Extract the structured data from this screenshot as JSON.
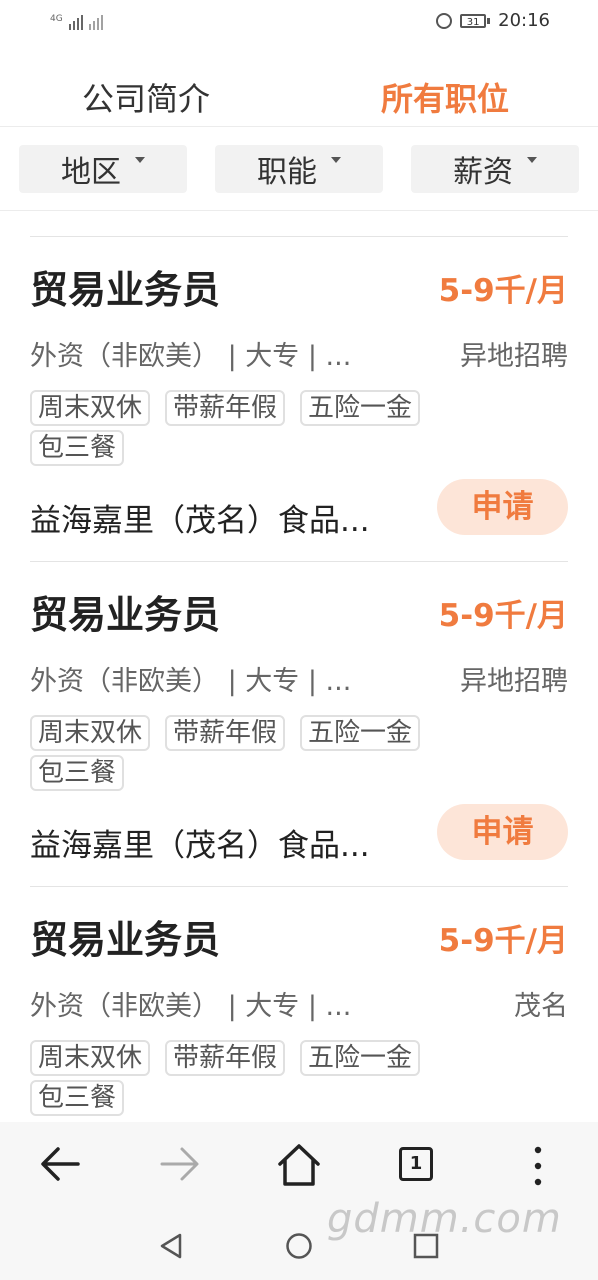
{
  "status_bar": {
    "network_label": "4G",
    "time": "20:16",
    "battery_level": "31"
  },
  "tabs": [
    {
      "label": "公司简介",
      "active": false
    },
    {
      "label": "所有职位",
      "active": true
    }
  ],
  "filters": [
    {
      "label": "地区"
    },
    {
      "label": "职能"
    },
    {
      "label": "薪资"
    }
  ],
  "jobs": [
    {
      "title": "贸易业务员",
      "salary": "5-9千/月",
      "meta": "外资（非欧美） | 大专 | ...",
      "location": "异地招聘",
      "tags": [
        "周末双休",
        "带薪年假",
        "五险一金",
        "包三餐"
      ],
      "company": "益海嘉里（茂名）食品...",
      "apply_label": "申请"
    },
    {
      "title": "贸易业务员",
      "salary": "5-9千/月",
      "meta": "外资（非欧美） | 大专 | ...",
      "location": "异地招聘",
      "tags": [
        "周末双休",
        "带薪年假",
        "五险一金",
        "包三餐"
      ],
      "company": "益海嘉里（茂名）食品...",
      "apply_label": "申请"
    },
    {
      "title": "贸易业务员",
      "salary": "5-9千/月",
      "meta": "外资（非欧美） | 大专 | ...",
      "location": "茂名",
      "tags": [
        "周末双休",
        "带薪年假",
        "五险一金",
        "包三餐"
      ]
    }
  ],
  "toolbar": {
    "tab_count": "1"
  },
  "watermark": "gdmm.com",
  "colors": {
    "accent": "#f07b3f",
    "apply_bg": "#fde5d8"
  }
}
